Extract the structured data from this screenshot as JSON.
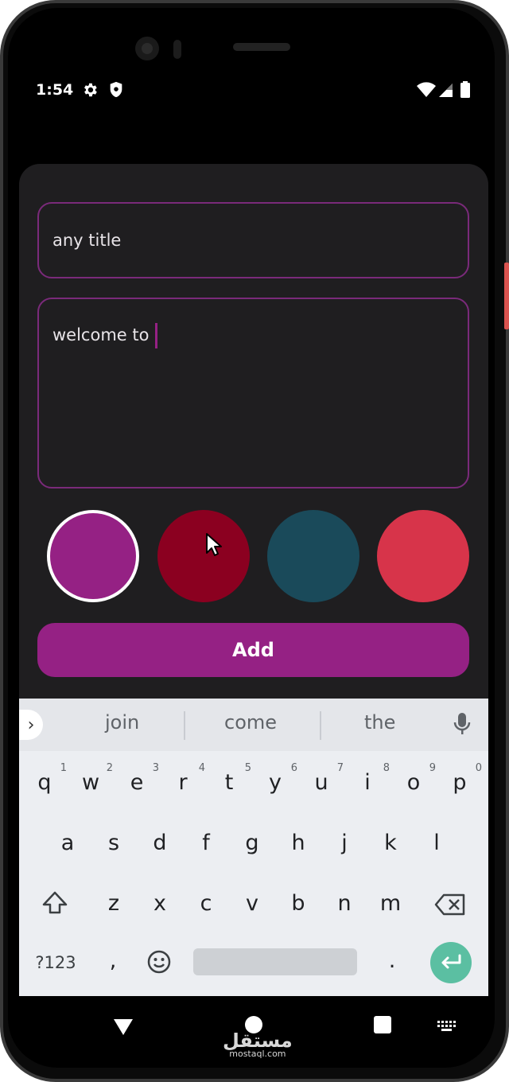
{
  "status_bar": {
    "time": "1:54"
  },
  "form": {
    "title_value": "any title",
    "content_value": "welcome to",
    "add_label": "Add"
  },
  "colors": {
    "accent": "#952184",
    "field_border": "#7a2a7a",
    "swatches": [
      "#952184",
      "#8b0020",
      "#1a4a5a",
      "#d7344a"
    ],
    "selected_swatch": 0
  },
  "keyboard": {
    "suggestions": [
      "join",
      "come",
      "the"
    ],
    "row1": [
      {
        "key": "q",
        "hint": "1"
      },
      {
        "key": "w",
        "hint": "2"
      },
      {
        "key": "e",
        "hint": "3"
      },
      {
        "key": "r",
        "hint": "4"
      },
      {
        "key": "t",
        "hint": "5"
      },
      {
        "key": "y",
        "hint": "6"
      },
      {
        "key": "u",
        "hint": "7"
      },
      {
        "key": "i",
        "hint": "8"
      },
      {
        "key": "o",
        "hint": "9"
      },
      {
        "key": "p",
        "hint": "0"
      }
    ],
    "row2": [
      "a",
      "s",
      "d",
      "f",
      "g",
      "h",
      "j",
      "k",
      "l"
    ],
    "row3": [
      "z",
      "x",
      "c",
      "v",
      "b",
      "n",
      "m"
    ],
    "symbols_label": "?123",
    "comma": ",",
    "period": "."
  },
  "icons": {
    "status": [
      "gear-icon",
      "shield-icon",
      "wifi-icon",
      "signal-icon",
      "battery-icon"
    ],
    "keyboard": [
      "chevron-right-icon",
      "mic-icon",
      "shift-icon",
      "backspace-icon",
      "emoji-icon",
      "enter-icon"
    ],
    "nav": [
      "back-icon",
      "home-icon",
      "recents-icon",
      "keyboard-switch-icon"
    ]
  },
  "watermark": {
    "main": "مستقل",
    "sub": "mostaql.com"
  }
}
